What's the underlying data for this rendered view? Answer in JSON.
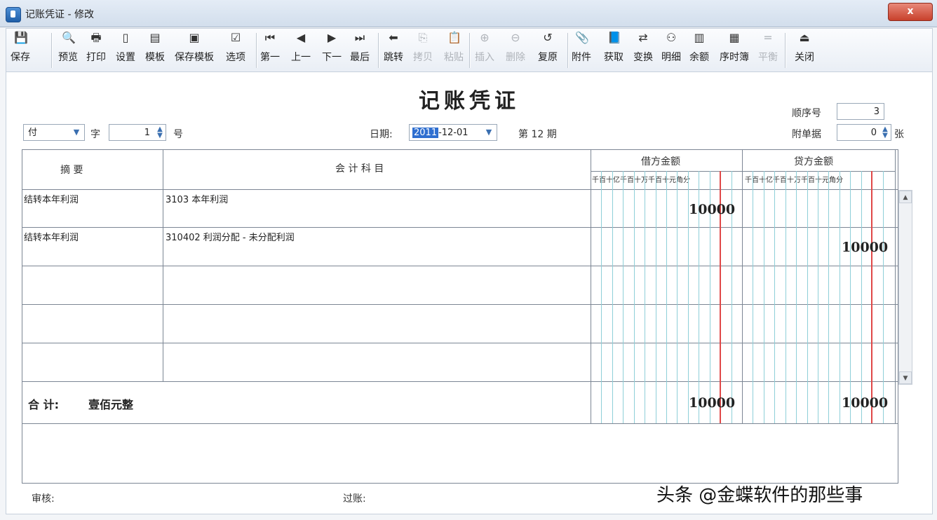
{
  "window": {
    "title": "记账凭证 - 修改",
    "close_label": "x"
  },
  "toolbar": {
    "buttons": [
      {
        "label": "保存",
        "icon": "save-icon"
      },
      {
        "label": "预览",
        "icon": "preview-icon"
      },
      {
        "label": "打印",
        "icon": "print-icon"
      },
      {
        "label": "设置",
        "icon": "page-setup-icon"
      },
      {
        "label": "模板",
        "icon": "template-icon"
      },
      {
        "label": "保存模板",
        "icon": "save-template-icon"
      },
      {
        "label": "选项",
        "icon": "options-icon"
      },
      {
        "label": "第一",
        "icon": "first-icon"
      },
      {
        "label": "上一",
        "icon": "prev-icon"
      },
      {
        "label": "下一",
        "icon": "next-icon"
      },
      {
        "label": "最后",
        "icon": "last-icon"
      },
      {
        "label": "跳转",
        "icon": "jump-icon"
      },
      {
        "label": "拷贝",
        "icon": "copy-icon"
      },
      {
        "label": "粘贴",
        "icon": "paste-icon"
      },
      {
        "label": "插入",
        "icon": "insert-icon"
      },
      {
        "label": "删除",
        "icon": "delete-icon"
      },
      {
        "label": "复原",
        "icon": "restore-icon"
      },
      {
        "label": "附件",
        "icon": "attachment-icon"
      },
      {
        "label": "获取",
        "icon": "fetch-icon"
      },
      {
        "label": "变换",
        "icon": "transform-icon"
      },
      {
        "label": "明细",
        "icon": "binoculars-icon"
      },
      {
        "label": "余额",
        "icon": "balance-icon"
      },
      {
        "label": "序时簿",
        "icon": "journal-icon"
      },
      {
        "label": "平衡",
        "icon": "equals-icon"
      },
      {
        "label": "关闭",
        "icon": "exit-icon"
      }
    ]
  },
  "voucher": {
    "title": "记账凭证",
    "type_value": "付",
    "zi_label": "字",
    "number_value": "1",
    "hao_label": "号",
    "date_label": "日期:",
    "date_year_selected": "2011",
    "date_rest": "-12-01",
    "period_label": "第 12 期",
    "seq_label": "顺序号",
    "seq_value": "3",
    "attach_label": "附单据",
    "attach_value": "0",
    "attach_unit": "张"
  },
  "grid": {
    "col_summary": "摘    要",
    "col_account": "会 计 科 目",
    "col_debit": "借方金额",
    "col_credit": "贷方金额",
    "digit_units": "千百十亿千百十万千百十元角分",
    "rows": [
      {
        "summary": "结转本年利润",
        "account": "3103 本年利润",
        "debit": "10000",
        "credit": ""
      },
      {
        "summary": "结转本年利润",
        "account": "310402 利润分配 - 未分配利润",
        "debit": "",
        "credit": "10000"
      },
      {
        "summary": "",
        "account": "",
        "debit": "",
        "credit": ""
      },
      {
        "summary": "",
        "account": "",
        "debit": "",
        "credit": ""
      },
      {
        "summary": "",
        "account": "",
        "debit": "",
        "credit": ""
      }
    ],
    "total_label": "合  计:",
    "total_words": "壹佰元整",
    "total_debit": "10000",
    "total_credit": "10000"
  },
  "footer": {
    "audit_label": "审核:",
    "post_label": "过账:"
  },
  "watermark": "头条 @金蝶软件的那些事"
}
